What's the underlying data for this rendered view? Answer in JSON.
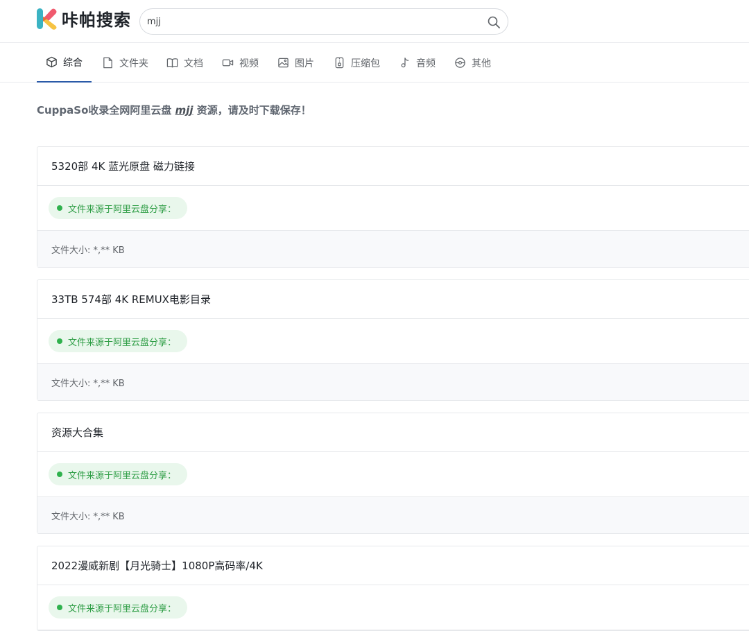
{
  "header": {
    "brand": "咔帕搜索",
    "search": {
      "value": "mjj",
      "placeholder": ""
    }
  },
  "tabs": [
    {
      "label": "综合",
      "icon": "cube-icon",
      "active": true
    },
    {
      "label": "文件夹",
      "icon": "file-icon"
    },
    {
      "label": "文档",
      "icon": "book-icon"
    },
    {
      "label": "视频",
      "icon": "video-icon"
    },
    {
      "label": "图片",
      "icon": "image-icon"
    },
    {
      "label": "压缩包",
      "icon": "zip-icon"
    },
    {
      "label": "音频",
      "icon": "music-note-icon"
    },
    {
      "label": "其他",
      "icon": "disc-icon"
    }
  ],
  "notice": {
    "prefix": "CuppaSo收录全网阿里云盘 ",
    "keyword": "mjj",
    "suffix": " 资源，请及时下载保存！"
  },
  "results": [
    {
      "title": "5320部 4K 蓝光原盘 磁力链接",
      "source": "文件来源于阿里云盘分享：",
      "size": "文件大小: *,** KB"
    },
    {
      "title": "33TB 574部 4K REMUX电影目录",
      "source": "文件来源于阿里云盘分享：",
      "size": "文件大小: *,** KB"
    },
    {
      "title": "资源大合集",
      "source": "文件来源于阿里云盘分享：",
      "size": "文件大小: *,** KB"
    },
    {
      "title": "2022漫威新剧【月光骑士】1080P高码率/4K",
      "source": "文件来源于阿里云盘分享：",
      "size": ""
    }
  ],
  "colors": {
    "accent": "#2b5aa8",
    "source_text": "#2f9e46",
    "source_bg": "#e9f7ec"
  }
}
